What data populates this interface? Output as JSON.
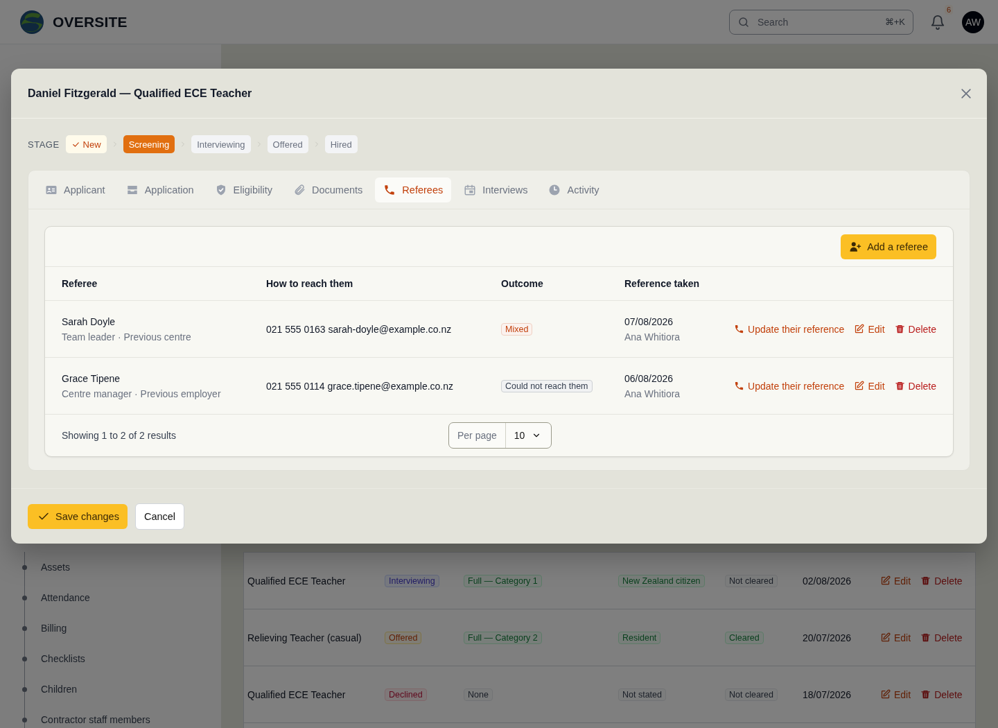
{
  "header": {
    "logo_text": "OVERSITE",
    "search": {
      "placeholder": "Search",
      "shortcut": "⌘+K"
    },
    "notifications": {
      "count": "6"
    },
    "avatar": {
      "initials": "AW"
    }
  },
  "sidebar": {
    "items": [
      {
        "label": "Assets"
      },
      {
        "label": "Attendance"
      },
      {
        "label": "Billing"
      },
      {
        "label": "Checklists"
      },
      {
        "label": "Children"
      },
      {
        "label": "Contractor staff members"
      }
    ]
  },
  "background_table": {
    "rows": [
      {
        "title": "Qualified ECE Teacher",
        "stage": {
          "text": "Interviewing",
          "kind": "indigo"
        },
        "category": {
          "text": "Full — Category 1",
          "kind": "green"
        },
        "residency": {
          "text": "New Zealand citizen",
          "kind": "green"
        },
        "police_check": {
          "text": "Not cleared",
          "kind": "gray"
        },
        "date": "02/08/2026",
        "actions": [
          "Edit",
          "Delete"
        ]
      },
      {
        "title": "Relieving Teacher (casual)",
        "stage": {
          "text": "Offered",
          "kind": "amber"
        },
        "category": {
          "text": "Full — Category 2",
          "kind": "green"
        },
        "residency": {
          "text": "Resident",
          "kind": "green"
        },
        "police_check": {
          "text": "Cleared",
          "kind": "green"
        },
        "date": "20/07/2026",
        "actions": [
          "Edit",
          "Delete"
        ]
      },
      {
        "title": "Qualified ECE Teacher",
        "stage": {
          "text": "Declined",
          "kind": "red"
        },
        "category": {
          "text": "None",
          "kind": "gray"
        },
        "residency": {
          "text": "Not stated",
          "kind": "gray"
        },
        "police_check": {
          "text": "Not cleared",
          "kind": "gray"
        },
        "date": "18/07/2026",
        "actions": [
          "Edit",
          "Delete"
        ]
      }
    ]
  },
  "modal": {
    "title": "Daniel Fitzgerald — Qualified ECE Teacher",
    "stage": {
      "label": "STAGE",
      "steps": [
        {
          "label": "New",
          "completed": true,
          "selected": false
        },
        {
          "label": "Screening",
          "completed": false,
          "selected": true
        },
        {
          "label": "Interviewing",
          "completed": false,
          "selected": false
        },
        {
          "label": "Offered",
          "completed": false,
          "selected": false
        },
        {
          "label": "Hired",
          "completed": false,
          "selected": false
        }
      ]
    },
    "tabs": [
      {
        "label": "Applicant",
        "selected": false
      },
      {
        "label": "Application",
        "selected": false
      },
      {
        "label": "Eligibility",
        "selected": false
      },
      {
        "label": "Documents",
        "selected": false
      },
      {
        "label": "Referees",
        "selected": true
      },
      {
        "label": "Interviews",
        "selected": false
      },
      {
        "label": "Activity",
        "selected": false
      }
    ],
    "add_button": "Add a referee",
    "table": {
      "columns": [
        "Referee",
        "How to reach them",
        "Outcome",
        "Reference taken"
      ],
      "rows": [
        {
          "name": "Sarah Doyle",
          "detail": "Team leader · Previous centre",
          "contact": "021 555 0163 sarah-doyle@example.co.nz",
          "outcome": {
            "text": "Mixed",
            "color": "#c2410c"
          },
          "date": "07/08/2026",
          "taken_by": "Ana Whitiora",
          "actions": [
            "Update their reference",
            "Edit",
            "Delete"
          ]
        },
        {
          "name": "Grace Tipene",
          "detail": "Centre manager · Previous employer",
          "contact": "021 555 0114 grace.tipene@example.co.nz",
          "outcome": {
            "text": "Could not reach them",
            "color": "#374151"
          },
          "date": "06/08/2026",
          "taken_by": "Ana Whitiora",
          "actions": [
            "Update their reference",
            "Edit",
            "Delete"
          ]
        }
      ]
    },
    "pagination": {
      "summary": "Showing 1 to 2 of 2 results",
      "per_page": {
        "label": "Per page",
        "value": "10"
      }
    },
    "buttons": [
      "Save changes",
      "Cancel"
    ]
  }
}
